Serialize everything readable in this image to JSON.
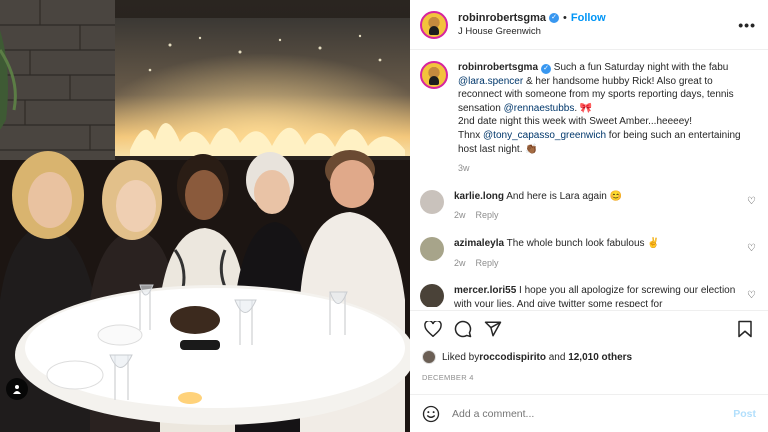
{
  "post": {
    "author": "robinrobertsgma",
    "follow_label": "Follow",
    "separator": "•",
    "location": "J House Greenwich",
    "more_label": "•••"
  },
  "caption": {
    "author": "robinrobertsgma",
    "text1": " Such a fun Saturday night with the fabu ",
    "mention1": "@lara.spencer",
    "text2": " & her handsome hubby Rick! Also great to reconnect with someone from my sports reporting days, tennis sensation ",
    "mention2": "@rennaestubbs",
    "text3": ". 🎀",
    "line2": "2nd date night this week with Sweet Amber...heeeey!",
    "text4": "Thnx ",
    "mention3": "@tony_capasso_greenwich",
    "text5": " for being such an entertaining host last night. 👏🏾",
    "age": "3w"
  },
  "comments": [
    {
      "user": "karlie.long",
      "text": " And here is Lara again 😊",
      "age": "2w",
      "reply": "Reply",
      "avatar_color": "#c9c2bc"
    },
    {
      "user": "azimaleyla",
      "text": " The whole bunch look fabulous ✌️",
      "age": "2w",
      "reply": "Reply",
      "avatar_color": "#a7a48a"
    },
    {
      "user": "mercer.lori55",
      "text": " I hope you all apologize for screwing our election with your lies. And give twitter some respect for",
      "age": "",
      "reply": "",
      "avatar_color": "#4a4238"
    }
  ],
  "likes": {
    "prefix": "Liked by ",
    "user": "roccodispirito",
    "middle": " and ",
    "count": "12,010 others"
  },
  "date": "DECEMBER 4",
  "add_comment": {
    "placeholder": "Add a comment...",
    "post_label": "Post"
  },
  "colors": {
    "accent": "#0095f6",
    "verified": "#3897f0",
    "mention": "#00376b",
    "muted": "#8e8e8e"
  }
}
